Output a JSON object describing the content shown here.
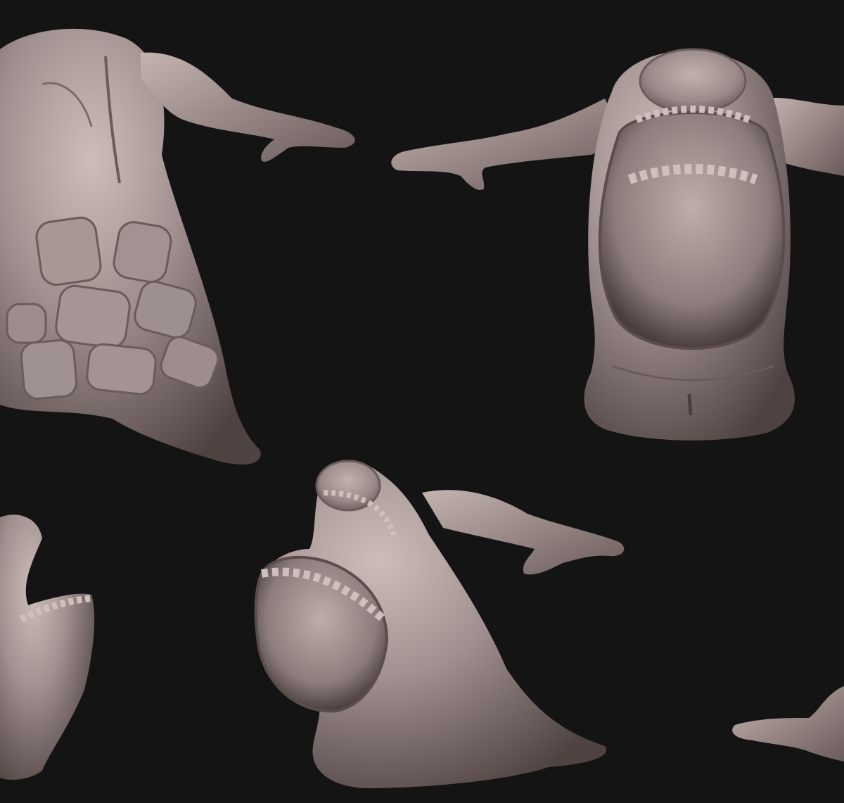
{
  "scene": {
    "background_color": "#141414",
    "clay_color": "#a0908f",
    "clay_highlight": "#c9b9b6",
    "clay_shadow": "#5a4d4c",
    "views": [
      {
        "id": "back-view"
      },
      {
        "id": "front-view"
      },
      {
        "id": "side-view-left-partial"
      },
      {
        "id": "three-quarter-view"
      },
      {
        "id": "side-view-right-partial"
      }
    ]
  }
}
